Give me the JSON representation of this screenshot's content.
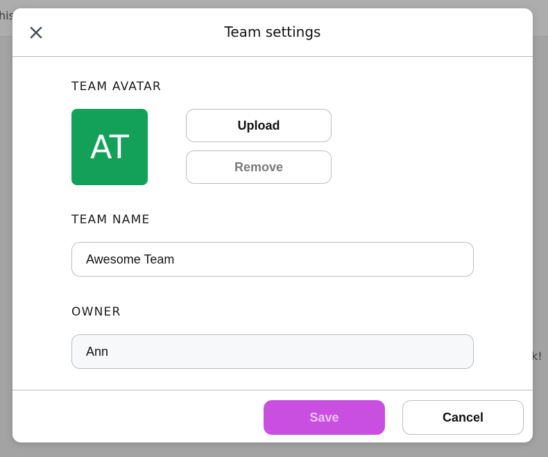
{
  "background": {
    "left_text": "his",
    "right_text": "k!"
  },
  "modal": {
    "title": "Team settings",
    "close_icon": "close-icon"
  },
  "avatar_section": {
    "label": "TEAM AVATAR",
    "initials": "AT",
    "color": "#13a058",
    "upload_label": "Upload",
    "remove_label": "Remove"
  },
  "name_section": {
    "label": "TEAM NAME",
    "value": "Awesome Team"
  },
  "owner_section": {
    "label": "OWNER",
    "value": "Ann"
  },
  "footer": {
    "save_label": "Save",
    "cancel_label": "Cancel",
    "save_color": "#c84fe0",
    "save_text_color": "#eac4f3"
  },
  "colors": {
    "border": "#b8bcc4",
    "disabled_text": "#7a7a7a",
    "owner_field_bg": "#f6f8fa"
  }
}
